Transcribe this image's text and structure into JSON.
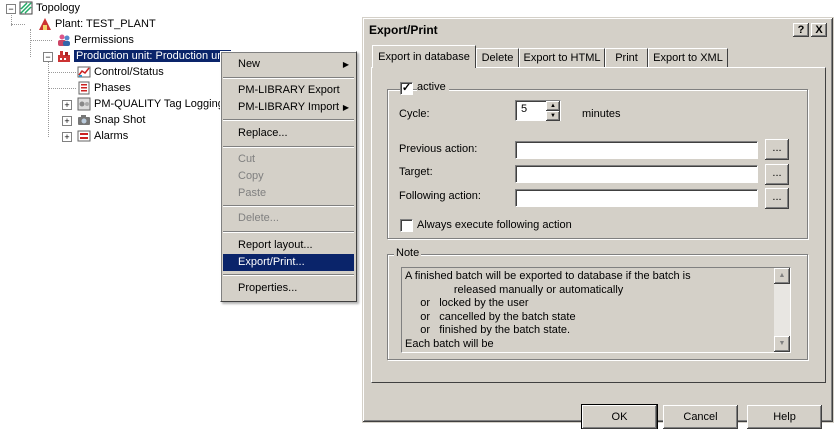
{
  "tree": {
    "root": "Topology",
    "plant": "Plant: TEST_PLANT",
    "permissions": "Permissions",
    "production_unit": "Production unit: Production unit",
    "control_status": "Control/Status",
    "phases": "Phases",
    "pm_quality": "PM-QUALITY Tag Logging",
    "snap_shot": "Snap Shot",
    "alarms": "Alarms"
  },
  "context_menu": {
    "new": "New",
    "pm_export": "PM-LIBRARY Export",
    "pm_import": "PM-LIBRARY Import",
    "replace": "Replace...",
    "cut": "Cut",
    "copy": "Copy",
    "paste": "Paste",
    "delete": "Delete...",
    "report_layout": "Report layout...",
    "export_print": "Export/Print...",
    "properties": "Properties..."
  },
  "dialog": {
    "title": "Export/Print",
    "help_btn": "?",
    "close_btn": "X",
    "tabs": [
      "Export in database",
      "Delete",
      "Export to HTML",
      "Print",
      "Export to XML"
    ],
    "active_label": "active",
    "active_checked": true,
    "cycle_label": "Cycle:",
    "cycle_value": "5",
    "cycle_unit": "minutes",
    "previous_action_label": "Previous action:",
    "target_label": "Target:",
    "following_action_label": "Following action:",
    "browse_label": "...",
    "always_execute_label": "Always execute following action",
    "always_execute_checked": false,
    "note_label": "Note",
    "note_lines": [
      "A finished batch will be exported to database if the batch is",
      "                released manually or automatically",
      "     or   locked by the user",
      "     or   cancelled by the batch state",
      "     or   finished by the batch state.",
      "Each batch will be"
    ],
    "ok": "OK",
    "cancel": "Cancel",
    "help": "Help"
  }
}
